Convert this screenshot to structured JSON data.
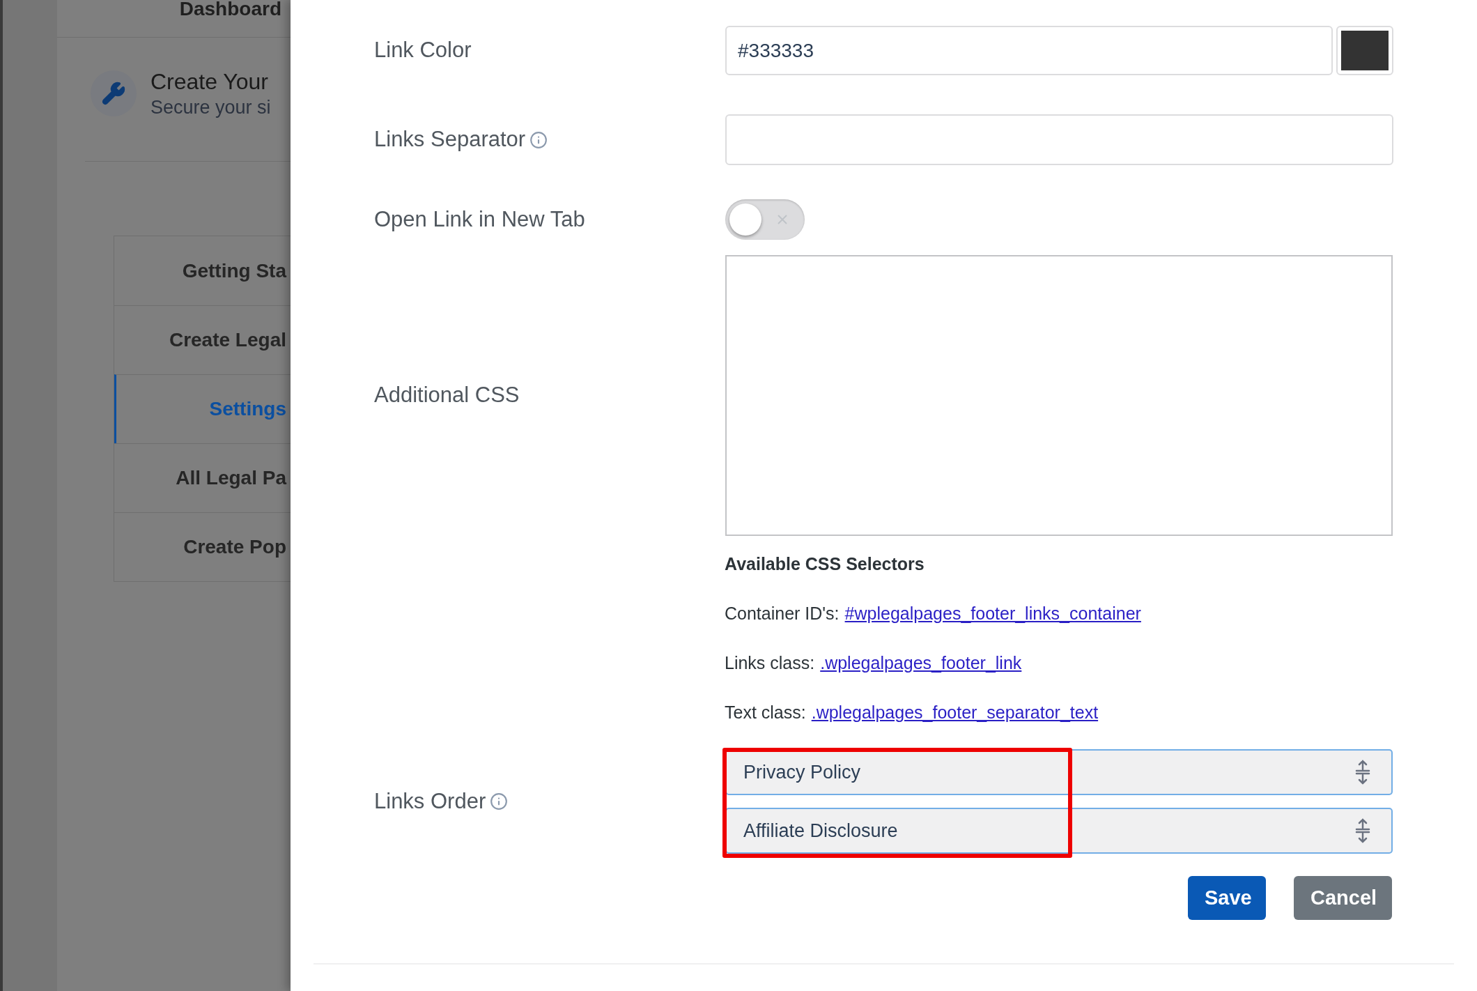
{
  "background": {
    "dashboard": "Dashboard",
    "card": {
      "title": "Create Your",
      "subtitle": "Secure your si"
    },
    "nav": [
      {
        "label": "Getting Sta",
        "selected": false
      },
      {
        "label": "Create Legal",
        "selected": false
      },
      {
        "label": "Settings",
        "selected": true
      },
      {
        "label": "All Legal Pa",
        "selected": false
      },
      {
        "label": "Create Pop",
        "selected": false
      }
    ]
  },
  "form": {
    "link_color": {
      "label": "Link Color",
      "value": "#333333",
      "color": "#333333"
    },
    "links_separator": {
      "label": "Links Separator",
      "info": true
    },
    "open_in_new_tab": {
      "label": "Open Link in New Tab",
      "on": false
    },
    "additional_css": {
      "label": "Additional CSS"
    },
    "selectors": {
      "heading": "Available CSS Selectors",
      "lines": [
        {
          "prefix": "Container ID's:",
          "link": "#wplegalpages_footer_links_container"
        },
        {
          "prefix": "Links class:",
          "link": ".wplegalpages_footer_link"
        },
        {
          "prefix": "Text class:",
          "link": ".wplegalpages_footer_separator_text"
        }
      ]
    },
    "links_order": {
      "label": "Links Order",
      "info": true,
      "highlighted": true,
      "items": [
        {
          "label": "Privacy Policy"
        },
        {
          "label": "Affiliate Disclosure"
        }
      ]
    },
    "buttons": [
      {
        "label": "Save",
        "kind": "primary"
      },
      {
        "label": "Cancel",
        "kind": "secondary"
      }
    ]
  }
}
